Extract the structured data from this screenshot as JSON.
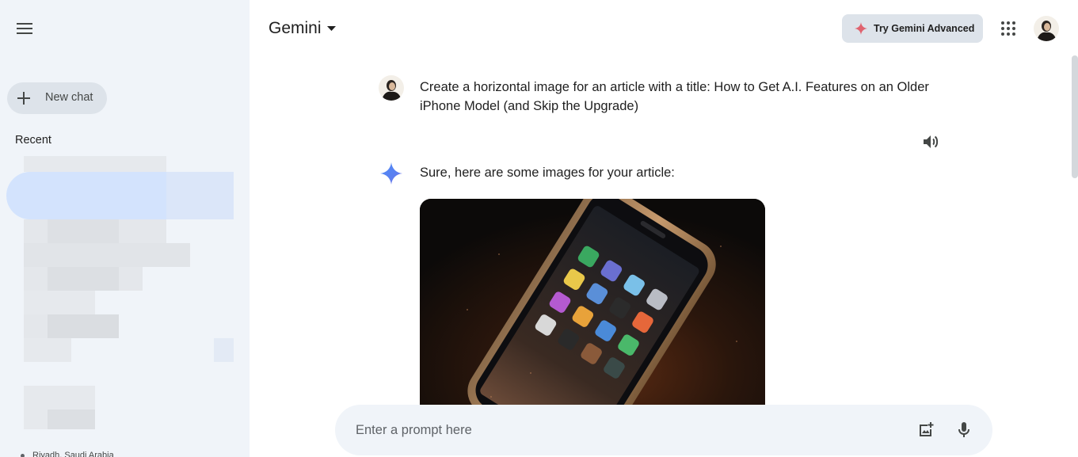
{
  "sidebar": {
    "menu_icon": "hamburger-menu-icon",
    "new_chat_label": "New chat",
    "recent_label": "Recent",
    "location": "Riyadh, Saudi Arabia"
  },
  "header": {
    "product_name": "Gemini",
    "advanced_label": "Try Gemini Advanced",
    "apps_icon": "apps-grid-icon"
  },
  "conversation": {
    "user_prompt": "Create a horizontal image for an article with a title: How to Get A.I. Features on an Older iPhone Model (and Skip the Upgrade)",
    "response_text": "Sure, here are some images for your article:"
  },
  "prompt": {
    "placeholder": "Enter a prompt here"
  },
  "colors": {
    "sidebar_bg": "#f0f4f9",
    "button_bg": "#dde3ea",
    "gemini_blue": "#4b8df8",
    "advanced_spark": "#e0636f"
  }
}
